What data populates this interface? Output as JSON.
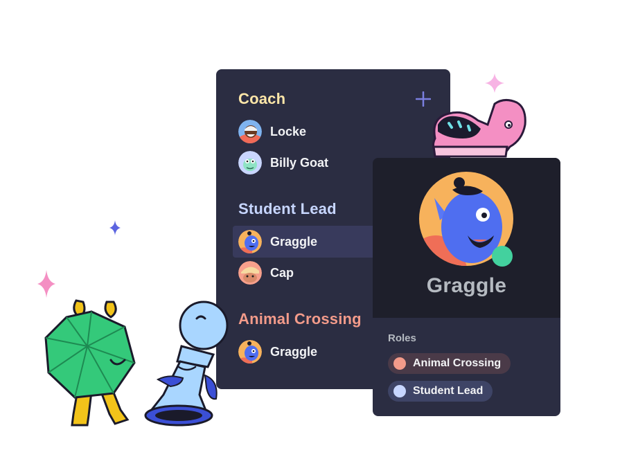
{
  "member_list": {
    "sections": [
      {
        "title": "Coach",
        "color": "#fde6a8",
        "members": [
          {
            "name": "Locke",
            "selected": false
          },
          {
            "name": "Billy Goat",
            "selected": false
          }
        ]
      },
      {
        "title": "Student Lead",
        "color": "#c7d6ff",
        "members": [
          {
            "name": "Graggle",
            "selected": true
          },
          {
            "name": "Cap",
            "selected": false
          }
        ]
      },
      {
        "title": "Animal Crossing",
        "color": "#f39b8a",
        "members": [
          {
            "name": "Graggle",
            "selected": false
          }
        ]
      }
    ],
    "add_icon": "plus-icon"
  },
  "profile": {
    "name": "Graggle",
    "status_color": "#43d19e",
    "roles_label": "Roles",
    "roles": [
      {
        "label": "Animal Crossing",
        "color": "#f39b8a",
        "pill_color": "#4a3a48"
      },
      {
        "label": "Student Lead",
        "color": "#c7d6ff",
        "pill_color": "#3e4466"
      }
    ]
  },
  "colors": {
    "panel_bg": "#2b2d42",
    "profile_header_bg": "#1e1f2b",
    "accent_purple": "#7b7fe0"
  }
}
